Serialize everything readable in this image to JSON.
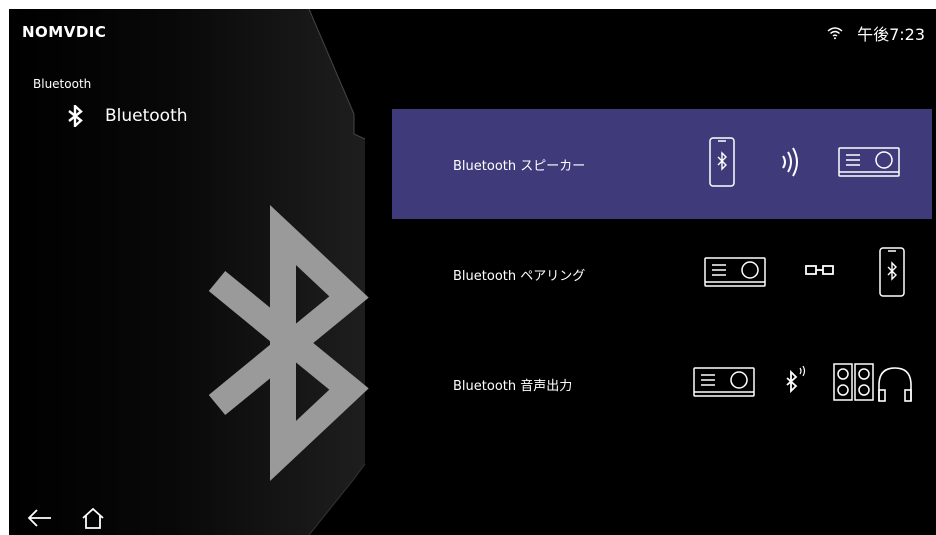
{
  "brand": {
    "logo": "NOMVDIC"
  },
  "status": {
    "time": "午後7:23",
    "wifi_icon": "wifi-icon"
  },
  "sidebar": {
    "breadcrumb": "Bluetooth",
    "title": "Bluetooth",
    "title_icon": "bluetooth-icon"
  },
  "menu": {
    "items": [
      {
        "label": "Bluetooth スピーカー",
        "selected": true
      },
      {
        "label": "Bluetooth ペアリング",
        "selected": false
      },
      {
        "label": "Bluetooth 音声出力",
        "selected": false
      }
    ]
  },
  "nav": {
    "back_icon": "back-arrow-icon",
    "home_icon": "home-icon"
  },
  "colors": {
    "background": "#000000",
    "selected_row": "#3f3a7a",
    "panel_gray": "#9a9a9a"
  }
}
